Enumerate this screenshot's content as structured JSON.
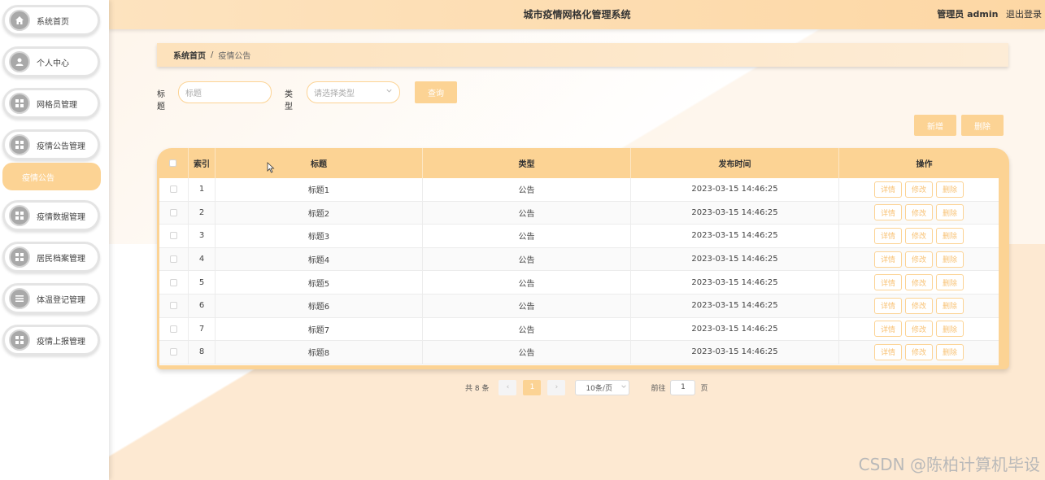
{
  "header": {
    "title": "城市疫情网格化管理系统",
    "user_role": "管理员 admin",
    "logout": "退出登录"
  },
  "sidebar": {
    "items": [
      {
        "label": "系统首页",
        "icon": "home-icon"
      },
      {
        "label": "个人中心",
        "icon": "user-icon"
      },
      {
        "label": "网格员管理",
        "icon": "grid-icon"
      },
      {
        "label": "疫情公告管理",
        "icon": "grid-icon"
      },
      {
        "label": "疫情数据管理",
        "icon": "grid-icon"
      },
      {
        "label": "居民档案管理",
        "icon": "grid-icon"
      },
      {
        "label": "体温登记管理",
        "icon": "list-icon"
      },
      {
        "label": "疫情上报管理",
        "icon": "grid-icon"
      }
    ],
    "active_sub": "疫情公告"
  },
  "breadcrumb": {
    "home": "系统首页",
    "sep": "/",
    "current": "疫情公告"
  },
  "search": {
    "title_label": "标题",
    "title_placeholder": "标题",
    "type_label": "类型",
    "type_placeholder": "请选择类型",
    "query_button": "查询"
  },
  "actions": {
    "add": "新增",
    "delete": "删除"
  },
  "table": {
    "headers": {
      "index": "索引",
      "title": "标题",
      "type": "类型",
      "time": "发布时间",
      "ops": "操作"
    },
    "ops": {
      "detail": "详情",
      "edit": "修改",
      "delete": "删除"
    },
    "rows": [
      {
        "index": "1",
        "title": "标题1",
        "type": "公告",
        "time": "2023-03-15 14:46:25"
      },
      {
        "index": "2",
        "title": "标题2",
        "type": "公告",
        "time": "2023-03-15 14:46:25"
      },
      {
        "index": "3",
        "title": "标题3",
        "type": "公告",
        "time": "2023-03-15 14:46:25"
      },
      {
        "index": "4",
        "title": "标题4",
        "type": "公告",
        "time": "2023-03-15 14:46:25"
      },
      {
        "index": "5",
        "title": "标题5",
        "type": "公告",
        "time": "2023-03-15 14:46:25"
      },
      {
        "index": "6",
        "title": "标题6",
        "type": "公告",
        "time": "2023-03-15 14:46:25"
      },
      {
        "index": "7",
        "title": "标题7",
        "type": "公告",
        "time": "2023-03-15 14:46:25"
      },
      {
        "index": "8",
        "title": "标题8",
        "type": "公告",
        "time": "2023-03-15 14:46:25"
      }
    ]
  },
  "pager": {
    "total": "共 8 条",
    "prev": "‹",
    "current": "1",
    "next": "›",
    "size": "10条/页",
    "goto": "前往",
    "page_value": "1",
    "page_unit": "页"
  },
  "watermark": "CSDN @陈柏计算机毕设",
  "colors": {
    "accent": "#fcd394",
    "header": "#fdd7a4"
  }
}
